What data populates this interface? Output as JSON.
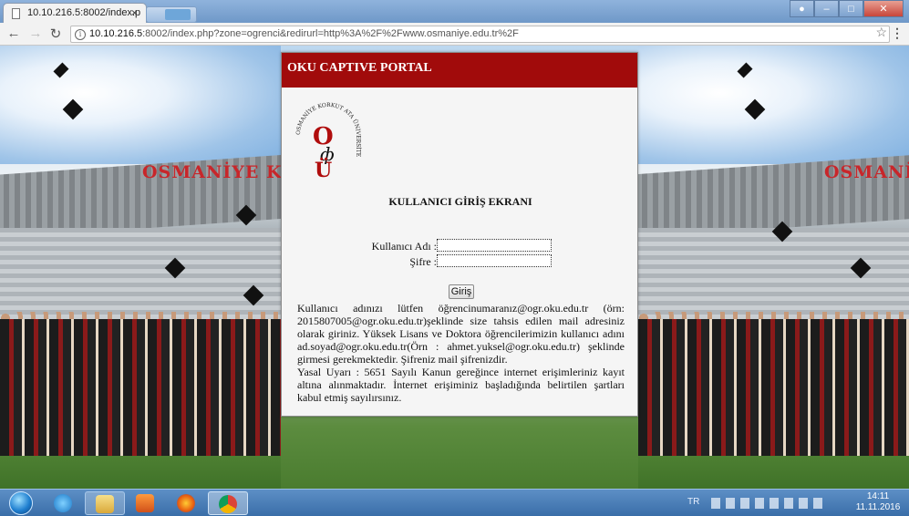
{
  "browser": {
    "tab_title": "10.10.216.5:8002/index.p",
    "tab_close": "×",
    "url_host": "10.10.216.5",
    "url_rest": ":8002/index.php?zone=ogrenci&redirurl=http%3A%2F%2Fwww.osmaniye.edu.tr%2F"
  },
  "page": {
    "bg_title_left": "OSMANİYE K",
    "bg_title_right": "OSMANİ"
  },
  "portal": {
    "header": "OKU CAPTIVE PORTAL",
    "logo_ring_text": "OSMANİYE KORKUT ATA ÜNİVERSİTESİ",
    "title": "KULLANICI GİRİŞ EKRANI",
    "username_label": "Kullanıcı Adı :",
    "username_value": "",
    "password_label": "Şifre :",
    "password_value": "",
    "login_button": "Giriş",
    "notice_1": "Kullanıcı adınızı lütfen öğrencinumaranız@ogr.oku.edu.tr (örn: 2015807005@ogr.oku.edu.tr)şeklinde size tahsis edilen mail adresiniz olarak giriniz. Yüksek Lisans ve Doktora öğrencilerimizin kullanıcı adını ad.soyad@ogr.oku.edu.tr(Örn : ahmet.yuksel@ogr.oku.edu.tr) şeklinde girmesi gerekmektedir. Şifreniz mail şifrenizdir.",
    "notice_2": "Yasal Uyarı : 5651 Sayılı Kanun gereğince internet erişimleriniz kayıt altına alınmaktadır. İnternet erişiminiz başladığında belirtilen şartları kabul etmiş sayılırsınız."
  },
  "taskbar": {
    "language": "TR",
    "time": "14:11",
    "date": "11.11.2016"
  },
  "colors": {
    "portal_header": "#a10b0b",
    "bg_title": "#c8262a"
  }
}
